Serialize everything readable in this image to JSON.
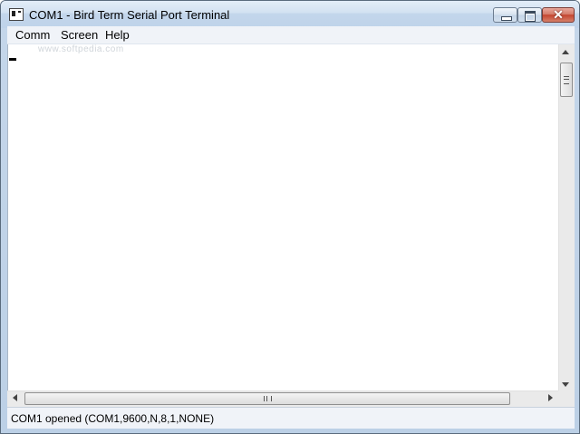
{
  "window": {
    "title": "COM1 - Bird Term Serial Port Terminal"
  },
  "menu": {
    "items": [
      "Comm",
      "Screen",
      "Help"
    ]
  },
  "terminal": {
    "watermark": "www.softpedia.com"
  },
  "status": {
    "text": "COM1 opened (COM1,9600,N,8,1,NONE)"
  },
  "icons": {
    "app": "terminal-icon",
    "minimize": "minimize-icon",
    "maximize": "maximize-icon",
    "close": "close-icon"
  }
}
